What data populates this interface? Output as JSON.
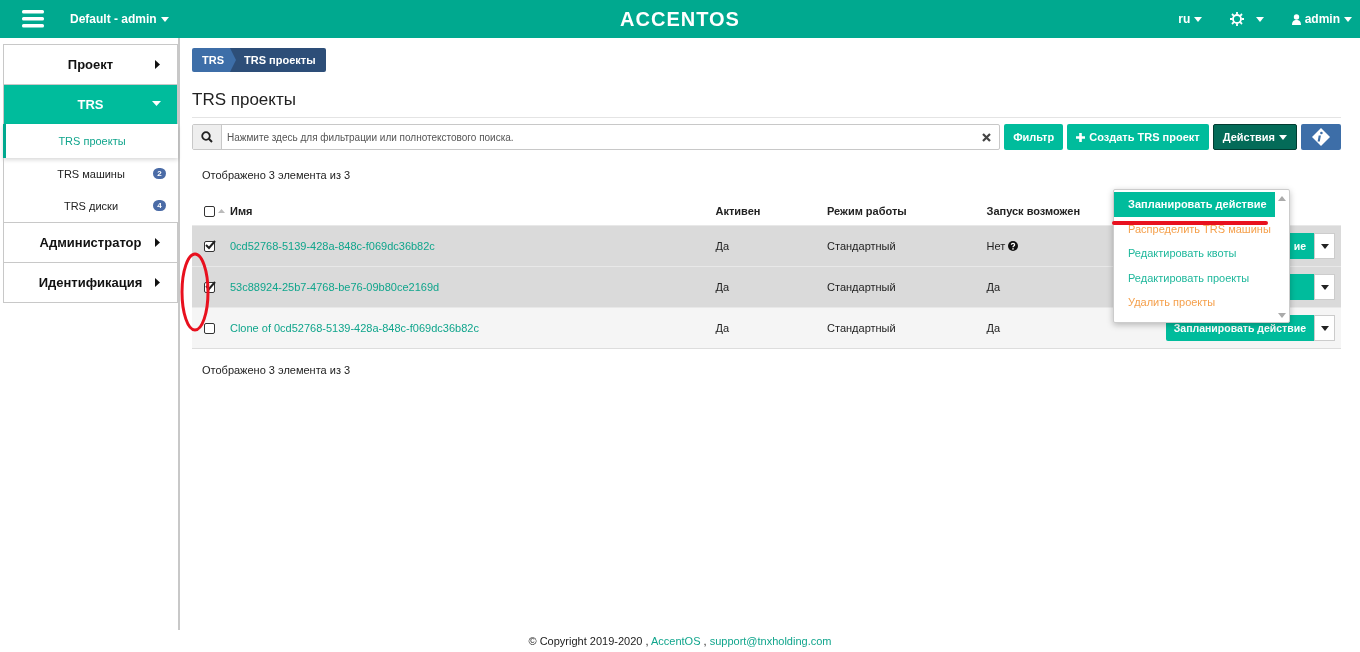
{
  "header": {
    "project_menu": "Default - admin",
    "logo": "ACCENTOS",
    "language": "ru",
    "user": "admin"
  },
  "sidebar": {
    "items": [
      {
        "label": "Проект",
        "expanded": false
      },
      {
        "label": "TRS",
        "expanded": true,
        "children": [
          {
            "label": "TRS проекты",
            "selected": true
          },
          {
            "label": "TRS машины",
            "selected": false,
            "badge": "2"
          },
          {
            "label": "TRS диски",
            "selected": false,
            "badge": "4"
          }
        ]
      },
      {
        "label": "Администратор",
        "expanded": false
      },
      {
        "label": "Идентификация",
        "expanded": false
      }
    ]
  },
  "breadcrumb": [
    "TRS",
    "TRS проекты"
  ],
  "page_title": "TRS проекты",
  "search": {
    "placeholder": "Нажмите здесь для фильтрации или полнотекстового поиска."
  },
  "toolbar": {
    "filter": "Фильтр",
    "create": "Создать TRS проект",
    "actions": "Действия"
  },
  "actions_menu": [
    {
      "label": "Запланировать действие",
      "selected": true,
      "color": "#00b89a"
    },
    {
      "label": "Распределить TRS машины",
      "selected": false,
      "color": "#f5a04c"
    },
    {
      "label": "Редактировать квоты",
      "selected": false,
      "color": "#1fb89c"
    },
    {
      "label": "Редактировать проекты",
      "selected": false,
      "color": "#1fb89c"
    },
    {
      "label": "Удалить проекты",
      "selected": false,
      "color": "#f5a04c"
    }
  ],
  "count_top": "Отображено 3 элемента из 3",
  "table": {
    "select_all": false,
    "columns": [
      "Имя",
      "Активен",
      "Режим работы",
      "Запуск возможен"
    ],
    "rows": [
      {
        "selected": true,
        "name": "0cd52768-5139-428a-848c-f069dc36b82c",
        "active": "Да",
        "mode": "Стандартный",
        "launch": "Нет",
        "help": true,
        "action": "ие"
      },
      {
        "selected": true,
        "name": "53c88924-25b7-4768-be76-09b80ce2169d",
        "active": "Да",
        "mode": "Стандартный",
        "launch": "Да",
        "help": false
      },
      {
        "selected": false,
        "name": "Clone of 0cd52768-5139-428a-848c-f069dc36b82c",
        "active": "Да",
        "mode": "Стандартный",
        "launch": "Да",
        "help": false,
        "action": "Запланировать действие"
      }
    ]
  },
  "count_bottom": "Отображено 3 элемента из 3",
  "footer": {
    "copyright": "© Copyright 2019-2020 ,",
    "links": [
      "AccentOS",
      "support@tnxholding.com"
    ],
    "separator": ","
  }
}
